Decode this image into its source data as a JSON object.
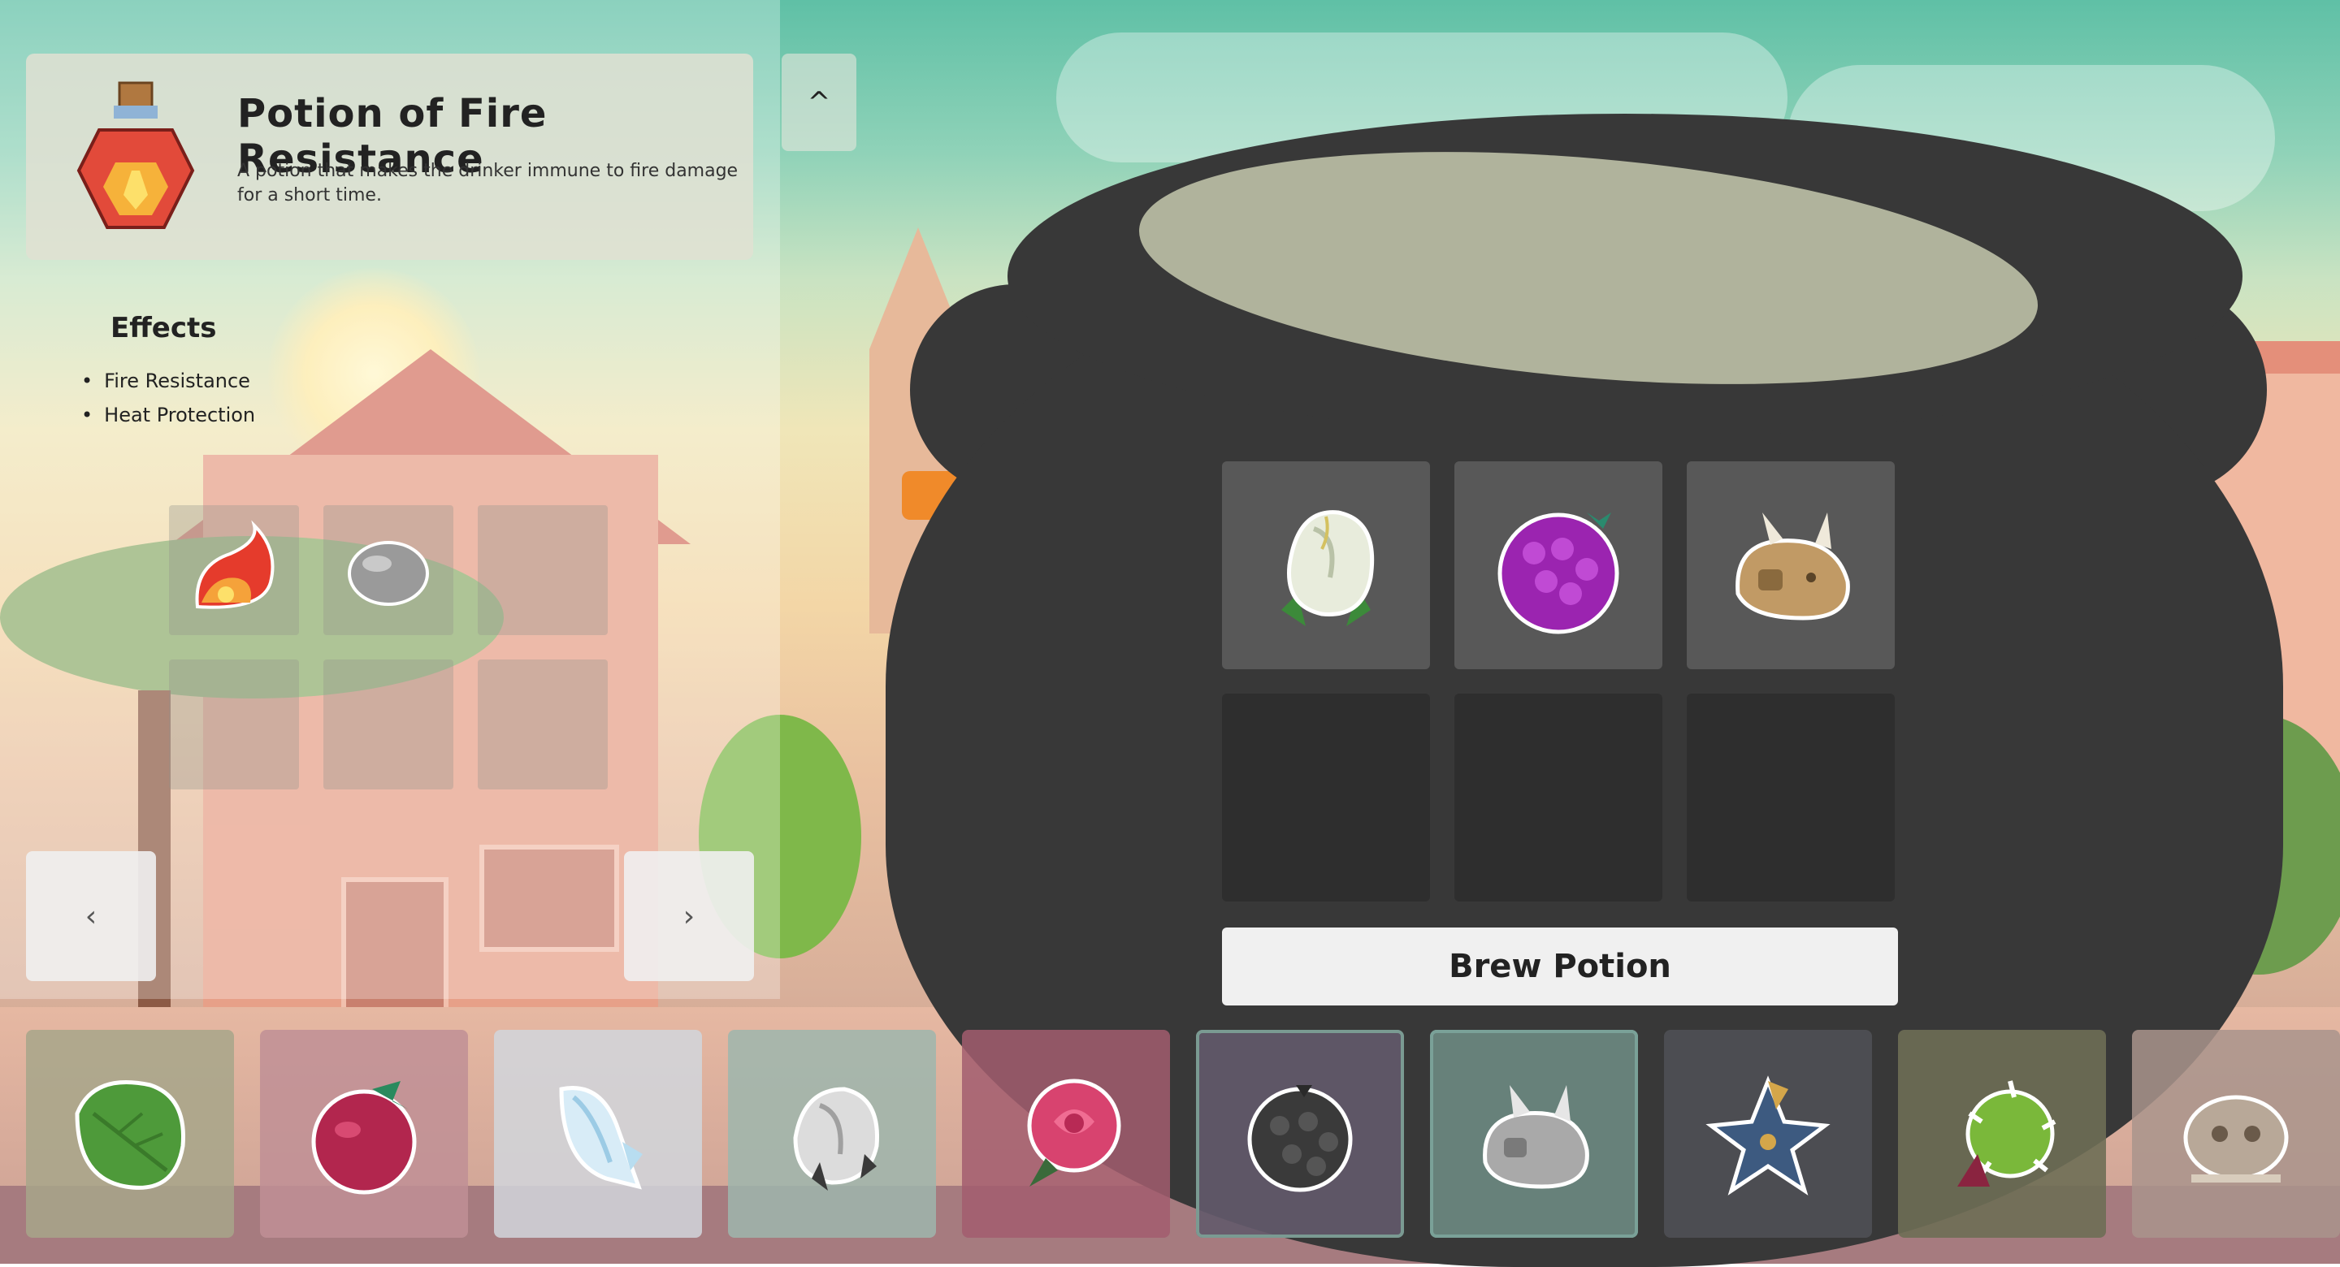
{
  "recipe": {
    "title": "Potion of Fire Resistance",
    "description": "A potion that makes the drinker immune to fire damage for a short time.",
    "icon": "fire-resistance-potion-icon",
    "close_icon": "close-icon",
    "effects_label": "Effects",
    "effects": [
      "Fire Resistance",
      "Heat Protection"
    ],
    "ingredient_slots": [
      {
        "icon": "fire-horn-icon",
        "filled": true
      },
      {
        "icon": "stone-icon",
        "filled": true
      },
      {
        "icon": "",
        "filled": false
      },
      {
        "icon": "",
        "filled": false
      },
      {
        "icon": "",
        "filled": false
      },
      {
        "icon": "",
        "filled": false
      }
    ],
    "prev_icon": "chevron-left-icon",
    "next_icon": "chevron-right-icon"
  },
  "cauldron": {
    "slots": [
      {
        "icon": "white-flower-bud-icon",
        "filled": true
      },
      {
        "icon": "purple-berry-icon",
        "filled": true
      },
      {
        "icon": "brown-horned-blob-icon",
        "filled": true
      },
      {
        "icon": "",
        "filled": false
      },
      {
        "icon": "",
        "filled": false
      },
      {
        "icon": "",
        "filled": false
      }
    ],
    "brew_button_label": "Brew Potion"
  },
  "inventory": [
    {
      "icon": "green-leaf-icon",
      "bg": "#a7a68a"
    },
    {
      "icon": "red-berry-icon",
      "bg": "#c08f95"
    },
    {
      "icon": "ice-crystal-icon",
      "bg": "#d1d6dc"
    },
    {
      "icon": "white-flower-bud-icon",
      "bg": "#9db6ad"
    },
    {
      "icon": "pink-rose-icon",
      "bg": "#a25d6e"
    },
    {
      "icon": "black-berry-icon",
      "bg": "#635a6c"
    },
    {
      "icon": "grey-horned-blob-icon",
      "bg": "#6d8a82"
    },
    {
      "icon": "blue-star-flower-icon",
      "bg": "#4f5055"
    },
    {
      "icon": "green-spiky-fruit-icon",
      "bg": "#6e6e55"
    },
    {
      "icon": "bone-pile-icon",
      "bg": "#a9948c"
    }
  ],
  "colors": {
    "cauldron": "#383838",
    "slot_filled": "#585858",
    "slot_empty": "#2e2e2e",
    "cauldron_lip": "#b0b39c"
  }
}
